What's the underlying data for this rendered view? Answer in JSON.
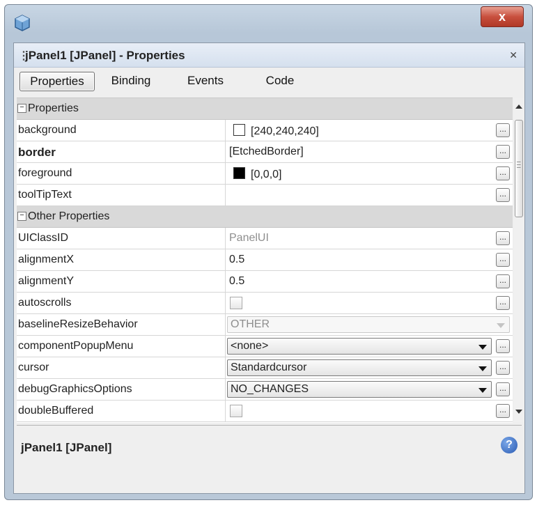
{
  "window": {
    "close_label": "x"
  },
  "panel": {
    "title": "jPanel1 [JPanel] - Properties",
    "pin_icon": "pin-icon"
  },
  "tabs": [
    "Properties",
    "Binding",
    "Events",
    "Code"
  ],
  "sections": {
    "properties": "Properties",
    "other": "Other Properties"
  },
  "properties": [
    {
      "name": "background",
      "value": "[240,240,240]",
      "swatch": "#ffffff"
    },
    {
      "name": "border",
      "value": "[EtchedBorder]"
    },
    {
      "name": "foreground",
      "value": "[0,0,0]",
      "swatch": "#000000"
    },
    {
      "name": "toolTipText",
      "value": ""
    }
  ],
  "other_properties": [
    {
      "name": "UIClassID",
      "value": "PanelUI"
    },
    {
      "name": "alignmentX",
      "value": "0.5"
    },
    {
      "name": "alignmentY",
      "value": "0.5"
    },
    {
      "name": "autoscrolls",
      "value": ""
    },
    {
      "name": "baselineResizeBehavior",
      "value": "OTHER"
    },
    {
      "name": "componentPopupMenu",
      "value": "<none>"
    },
    {
      "name": "cursor",
      "value": "Standardcursor"
    },
    {
      "name": "debugGraphicsOptions",
      "value": "NO_CHANGES"
    },
    {
      "name": "doubleBuffered",
      "value": ""
    }
  ],
  "footer": {
    "title": "jPanel1 [JPanel]",
    "help": "?"
  },
  "buttons": {
    "ellipsis": "..."
  }
}
